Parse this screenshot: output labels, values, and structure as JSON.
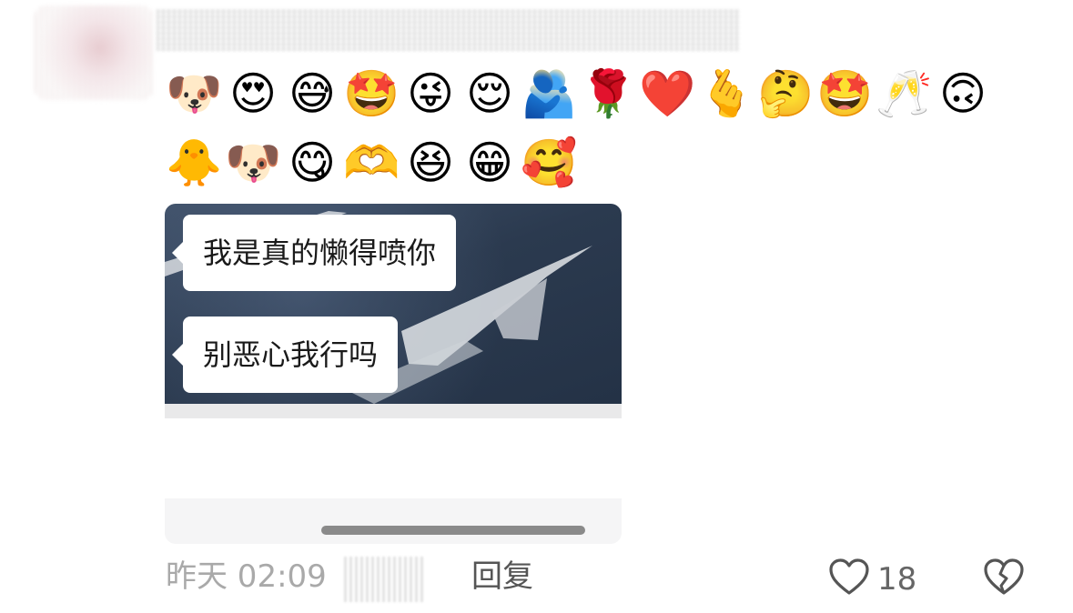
{
  "emojis": {
    "row1": [
      {
        "name": "pug-tongue-icon",
        "glyph": "🐶"
      },
      {
        "name": "heart-eyes-kiss-icon",
        "glyph": "😍"
      },
      {
        "name": "grin-sweat-icon",
        "glyph": "😅"
      },
      {
        "name": "heart-eyes-tongue-icon",
        "glyph": "🤩"
      },
      {
        "name": "wink-tongue-icon",
        "glyph": "😜"
      },
      {
        "name": "content-smile-icon",
        "glyph": "😌"
      },
      {
        "name": "hug-icon",
        "glyph": "🫂"
      },
      {
        "name": "rose-icon",
        "glyph": "🌹"
      },
      {
        "name": "red-heart-icon",
        "glyph": "❤️"
      },
      {
        "name": "finger-heart-icon",
        "glyph": "🫰"
      },
      {
        "name": "thinking-face-icon",
        "glyph": "🤔"
      },
      {
        "name": "star-struck-icon",
        "glyph": "🤩"
      },
      {
        "name": "wine-toast-icon",
        "glyph": "🥂"
      },
      {
        "name": "blue-hair-face-icon",
        "glyph": "🙃"
      }
    ],
    "row2": [
      {
        "name": "chick-shy-icon",
        "glyph": "🐥"
      },
      {
        "name": "pug-tongue-icon",
        "glyph": "🐶"
      },
      {
        "name": "rose-mouth-icon",
        "glyph": "😋"
      },
      {
        "name": "heart-hands-icon",
        "glyph": "🫶"
      },
      {
        "name": "peace-laugh-icon",
        "glyph": "😆"
      },
      {
        "name": "big-grin-icon",
        "glyph": "😁"
      },
      {
        "name": "hug-heart-icon",
        "glyph": "🥰"
      }
    ]
  },
  "image_card": {
    "bubble_1": "我是真的懒得喷你",
    "bubble_2": "别恶心我行吗"
  },
  "footer": {
    "time": "昨天 02:09",
    "reply_label": "回复",
    "like_count": "18",
    "icons": {
      "like": "heart-outline-icon",
      "dislike": "broken-heart-icon"
    }
  }
}
